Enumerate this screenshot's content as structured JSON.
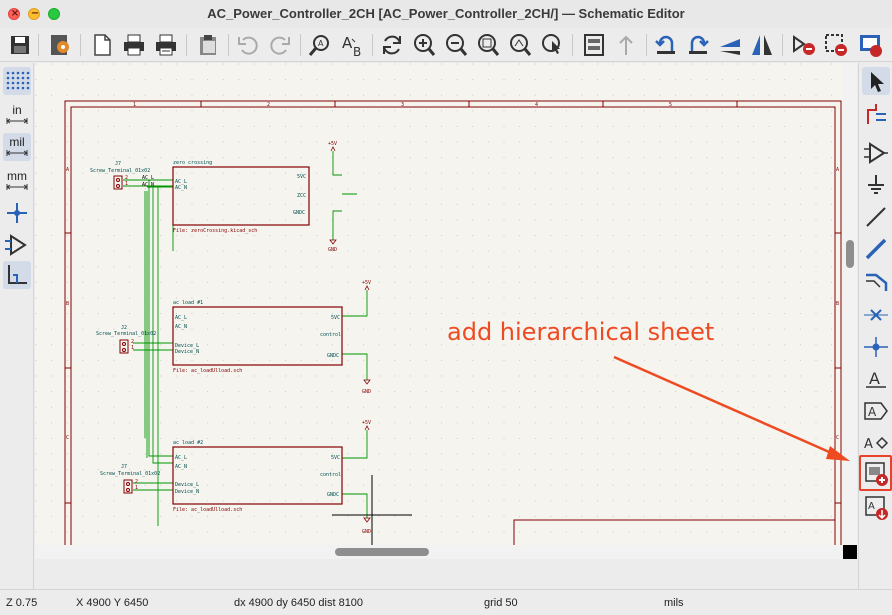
{
  "window": {
    "title": "AC_Power_Controller_2CH [AC_Power_Controller_2CH/] — Schematic Editor"
  },
  "toolbar": {
    "icons": [
      "save-icon",
      "schematic-setup-icon",
      "page-settings-icon",
      "print-icon",
      "plot-icon",
      "paste-icon",
      "undo-icon",
      "redo-icon",
      "find-icon",
      "find-replace-icon",
      "refresh-icon",
      "zoom-in-icon",
      "zoom-out-icon",
      "zoom-fit-icon",
      "zoom-objects-icon",
      "zoom-tool-icon",
      "hierarchy-navigator-icon",
      "leave-sheet-icon",
      "rotate-ccw-icon",
      "rotate-cw-icon",
      "mirror-v-icon",
      "mirror-h-icon",
      "annotate-icon",
      "erc-icon"
    ]
  },
  "left_toolbar": {
    "units": [
      "in",
      "mil",
      "mm"
    ]
  },
  "status": {
    "zoom": "Z 0.75",
    "xy": "X 4900  Y 6450",
    "delta": "dx 4900  dy 6450  dist 8100",
    "grid": "grid 50",
    "units": "mils"
  },
  "annotation": {
    "text": "add hierarchical sheet",
    "color": "#ee4b22"
  },
  "schematic": {
    "border_numbers": [
      "1",
      "2",
      "3",
      "4",
      "5"
    ],
    "border_letters": [
      "A",
      "B",
      "C"
    ],
    "conn1": {
      "ref": "J7",
      "value": "Screw_Terminal_01x02",
      "pins": [
        "2",
        "1"
      ],
      "nets": [
        "AC_L",
        "AC_N"
      ]
    },
    "conn2": {
      "ref": "J2",
      "value": "Screw_Terminal_01x02",
      "pins": [
        "2",
        "1"
      ]
    },
    "conn3": {
      "ref": "J7",
      "value": "Screw_Terminal_01x02",
      "pins": [
        "2",
        "1"
      ]
    },
    "sheet1": {
      "name": "zero crossing",
      "file": "File: zeroCrossing.kicad_sch",
      "left_pins": [
        "AC_L",
        "AC_N"
      ],
      "right_pins": [
        "5VC",
        "ZCC",
        "GNDC"
      ]
    },
    "sheet2": {
      "name": "ac load #1",
      "file": "File: ac_loadUlload.sch",
      "left_pins": [
        "AC_L",
        "AC_N",
        "Device_L",
        "Device_N"
      ],
      "right_pins": [
        "5VC",
        "control",
        "GNDC"
      ]
    },
    "sheet3": {
      "name": "ac load #2",
      "file": "File: ac_loadUlload.sch",
      "left_pins": [
        "AC_L",
        "AC_N",
        "Device_L",
        "Device_N"
      ],
      "right_pins": [
        "5VC",
        "control",
        "GNDC"
      ]
    },
    "power": {
      "vcc": "+5V",
      "gnd": "GND"
    }
  },
  "colors": {
    "sheet_border": "#840000",
    "wire": "#009600",
    "text": "#005050",
    "canvas": "#f5f4ef"
  }
}
